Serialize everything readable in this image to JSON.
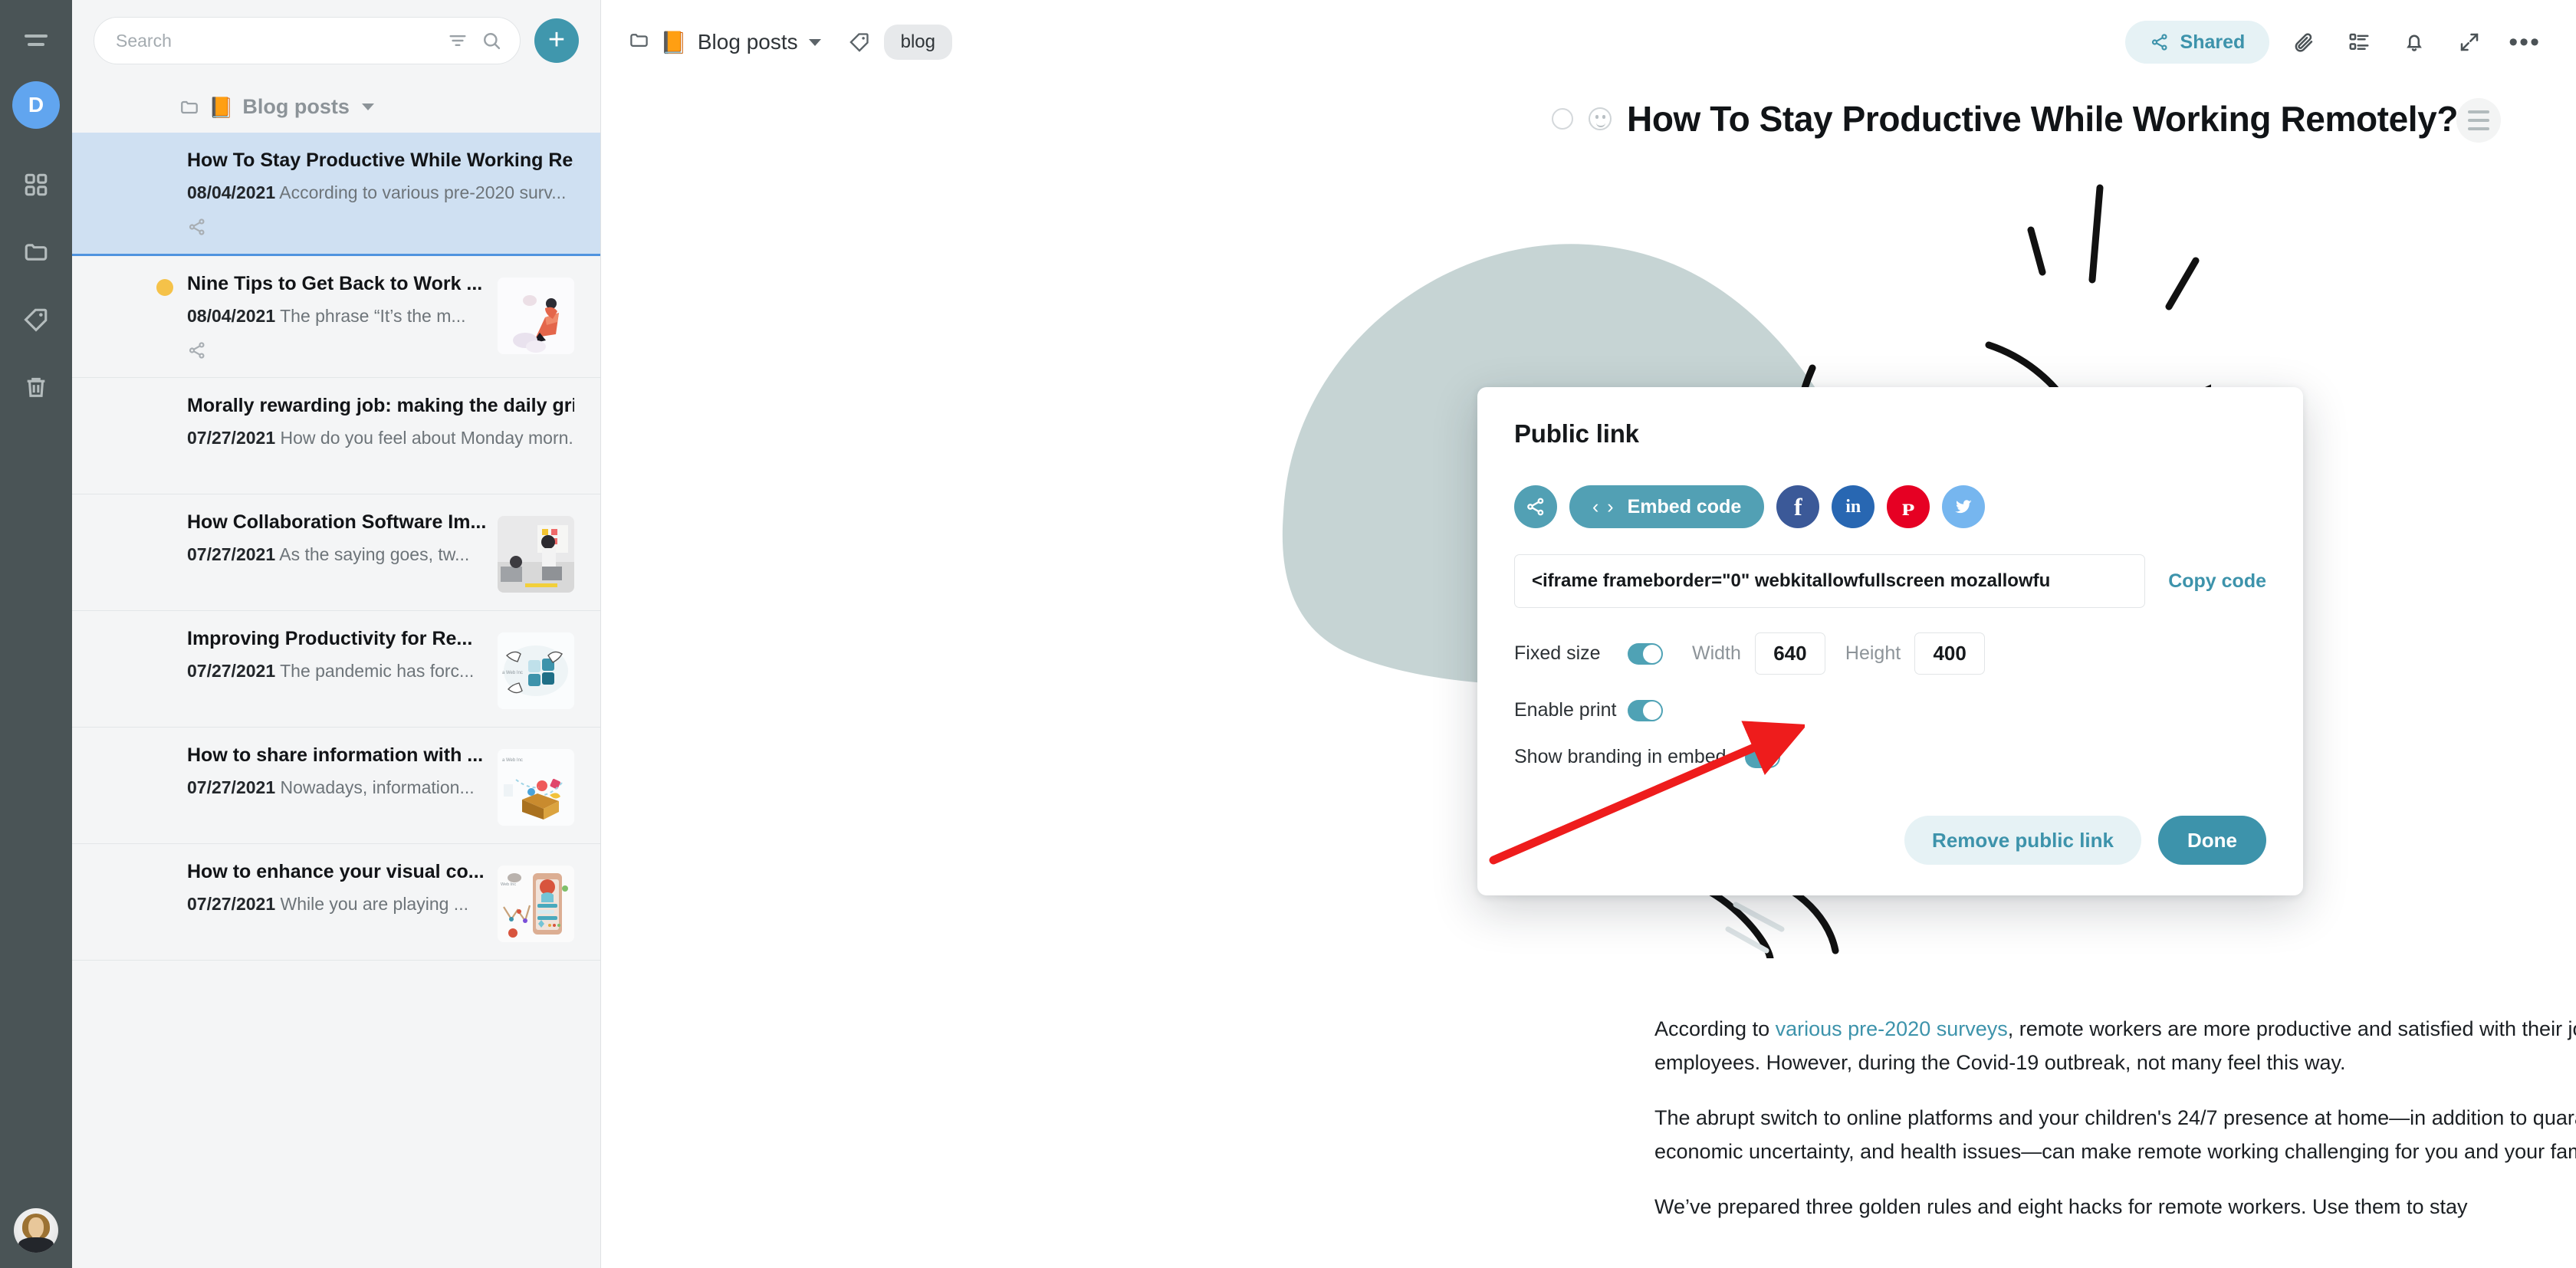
{
  "rail": {
    "menu_icon": "hamburger-icon",
    "avatar_initial": "D",
    "items": [
      {
        "icon": "grid-icon",
        "name": "dashboard"
      },
      {
        "icon": "folder-icon",
        "name": "folders"
      },
      {
        "icon": "tag-icon",
        "name": "tags"
      },
      {
        "icon": "trash-icon",
        "name": "trash"
      }
    ]
  },
  "search": {
    "placeholder": "Search",
    "value": "",
    "filter_icon": "filter-icon",
    "search_icon": "search-icon",
    "add_label": "+"
  },
  "folder_crumb": {
    "emoji": "📙",
    "name": "Blog posts"
  },
  "posts": [
    {
      "title": "How To Stay Productive While Working Re...",
      "date": "08/04/2021",
      "snippet": "According to various pre-2020 surv...",
      "selected": true,
      "dot": false,
      "thumb": "none",
      "share": true
    },
    {
      "title": "Nine Tips to Get Back to Work ...",
      "date": "08/04/2021",
      "snippet": "The phrase “It’s the m...",
      "selected": false,
      "dot": true,
      "thumb": "rocket",
      "share": true
    },
    {
      "title": "Morally rewarding job: making the daily gri...",
      "date": "07/27/2021",
      "snippet": "How do you feel about Monday morn...",
      "selected": false,
      "dot": false,
      "thumb": "none",
      "share": false
    },
    {
      "title": "How Collaboration Software Im...",
      "date": "07/27/2021",
      "snippet": "As the saying goes, tw...",
      "selected": false,
      "dot": false,
      "thumb": "office",
      "share": false
    },
    {
      "title": "Improving Productivity for Re...",
      "date": "07/27/2021",
      "snippet": "The pandemic has forc...",
      "selected": false,
      "dot": false,
      "thumb": "puzzle",
      "share": false
    },
    {
      "title": "How to share information with ...",
      "date": "07/27/2021",
      "snippet": "Nowadays, information...",
      "selected": false,
      "dot": false,
      "thumb": "box",
      "share": false
    },
    {
      "title": "How to enhance your visual co...",
      "date": "07/27/2021",
      "snippet": "While you are playing ...",
      "selected": false,
      "dot": false,
      "thumb": "phone",
      "share": false
    }
  ],
  "topbar": {
    "folder_emoji": "📙",
    "folder_name": "Blog posts",
    "tag_label": "blog",
    "shared_label": "Shared",
    "icons": [
      "attachment-icon",
      "tasks-icon",
      "bell-icon",
      "expand-icon",
      "more-icon"
    ],
    "more_glyph": "•••"
  },
  "document": {
    "title": "How To Stay Productive While Working Remotely?",
    "paragraphs": [
      {
        "before": "According to ",
        "link": "various pre-2020 surveys",
        "after": ", remote workers are more productive and satisfied with their jobs than office employees. However, during the Covid-19 outbreak, not many feel this way."
      },
      {
        "before": "The abrupt switch to online platforms and your children's 24/7 presence at home—in addition to quarantine, global economic uncertainty, and health issues—can make remote working challenging for you and your family members.",
        "link": "",
        "after": ""
      },
      {
        "before": "We’ve prepared three golden rules and eight hacks for remote workers. Use them to stay",
        "link": "",
        "after": ""
      }
    ]
  },
  "modal": {
    "title": "Public link",
    "share_icon_label": "share-icon",
    "embed_label": "Embed code",
    "embed_code_glyph": "‹ ›",
    "socials": [
      {
        "name": "facebook",
        "glyph": "f",
        "color": "#3b5998"
      },
      {
        "name": "linkedin",
        "glyph": "in",
        "color": "#2867b2"
      },
      {
        "name": "pinterest",
        "glyph": "ᴘ",
        "color": "#e60023"
      },
      {
        "name": "twitter",
        "glyph": "ᴛ",
        "color": "#76b6ef"
      }
    ],
    "code_value": "<iframe frameborder=\"0\" webkitallowfullscreen mozallowfu",
    "code_placeholder": "Embed code",
    "copy_label": "Copy code",
    "fixed_size_label": "Fixed size",
    "fixed_size_on": true,
    "width_label": "Width",
    "width_value": "640",
    "height_label": "Height",
    "height_value": "400",
    "enable_print_label": "Enable print",
    "enable_print_on": true,
    "branding_label": "Show branding in embed",
    "branding_on": true,
    "remove_label": "Remove public link",
    "done_label": "Done"
  },
  "colors": {
    "accent": "#3d93ab",
    "accent_soft": "#e6f2f5",
    "rail_bg": "#4a5456",
    "selected_row": "#cfe0f2",
    "annotation_arrow": "#ee1c1c",
    "illustration_blob": "#c3d2d2"
  }
}
